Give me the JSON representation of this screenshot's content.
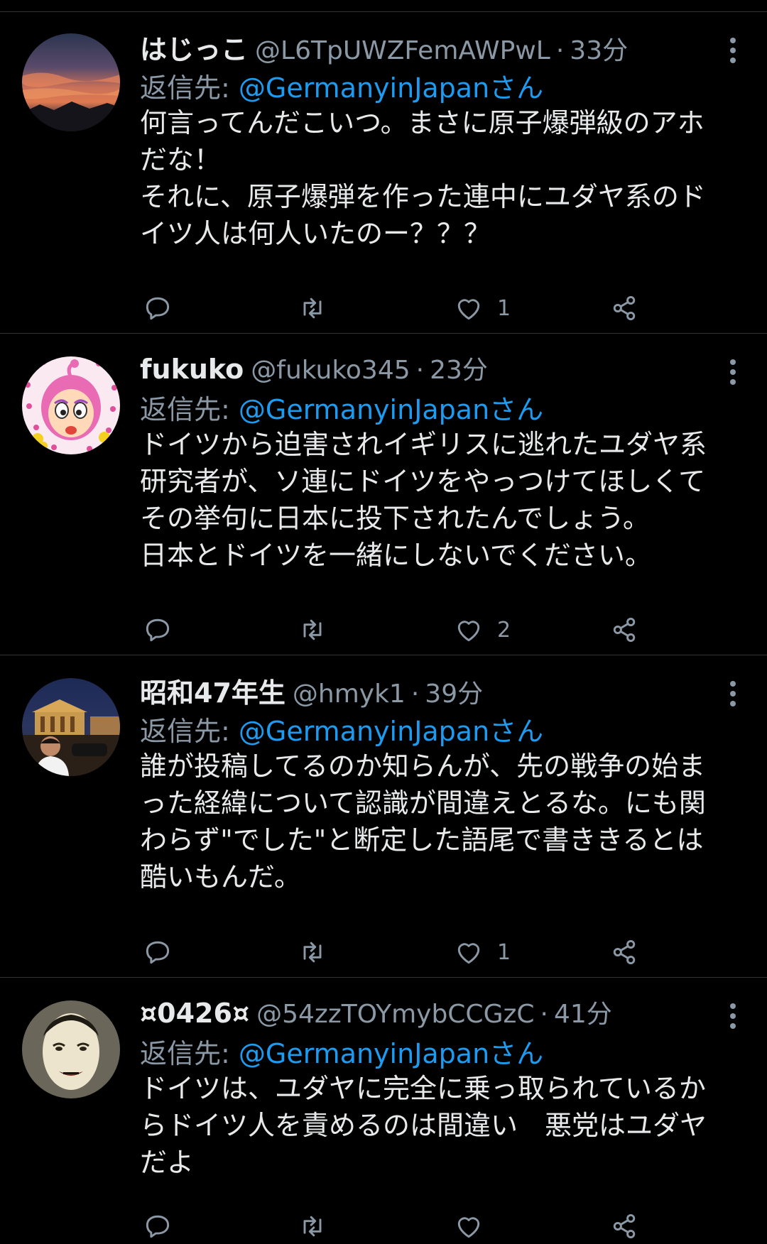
{
  "colors": {
    "background": "#000000",
    "divider": "#2f3336",
    "secondary_text": "#8b98a5",
    "primary_text": "#e7e9ea",
    "link": "#1d9bf0"
  },
  "tweets": [
    {
      "name": "はじっこ",
      "handle": "@L6TpUWZFemAWPwL",
      "separator": "·",
      "time": "33分",
      "reply_label": "返信先: ",
      "reply_handle": "@GermanyinJapan",
      "reply_suffix": "さん",
      "text": "何言ってんだこいつ。まさに原子爆弾級のアホ\nだな！\nそれに、原子爆弾を作った連中にユダヤ系のド\nイツ人は何人いたのー？？？",
      "likes": "1",
      "avatar": "sunset-sky-avatar"
    },
    {
      "name": "fukuko",
      "handle": "@fukuko345",
      "separator": "·",
      "time": "23分",
      "reply_label": "返信先: ",
      "reply_handle": "@GermanyinJapan",
      "reply_suffix": "さん",
      "text": "ドイツから迫害されイギリスに逃れたユダヤ系\n研究者が、ソ連にドイツをやっつけてほしくて\nその挙句に日本に投下されたんでしょう。\n日本とドイツを一緒にしないでください。",
      "likes": "2",
      "avatar": "cartoon-girl-avatar"
    },
    {
      "name": "昭和47年生",
      "handle": "@hmyk1",
      "separator": "·",
      "time": "39分",
      "reply_label": "返信先: ",
      "reply_handle": "@GermanyinJapan",
      "reply_suffix": "さん",
      "text": "誰が投稿してるのか知らんが、先の戦争の始ま\nった経緯について認識が間違えとるな。にも関\nわらず\"でした\"と断定した語尾で書ききるとは\n酷いもんだ。",
      "likes": "1",
      "avatar": "night-city-avatar"
    },
    {
      "name": "¤0426¤",
      "handle": "@54zzTOYmybCCGzC",
      "separator": "·",
      "time": "41分",
      "reply_label": "返信先: ",
      "reply_handle": "@GermanyinJapan",
      "reply_suffix": "さん",
      "text": "ドイツは、ユダヤに完全に乗っ取られているか\nらドイツ人を責めるのは間違い　悪党はユダヤ\nだよ",
      "likes": "",
      "avatar": "noh-mask-avatar"
    }
  ]
}
